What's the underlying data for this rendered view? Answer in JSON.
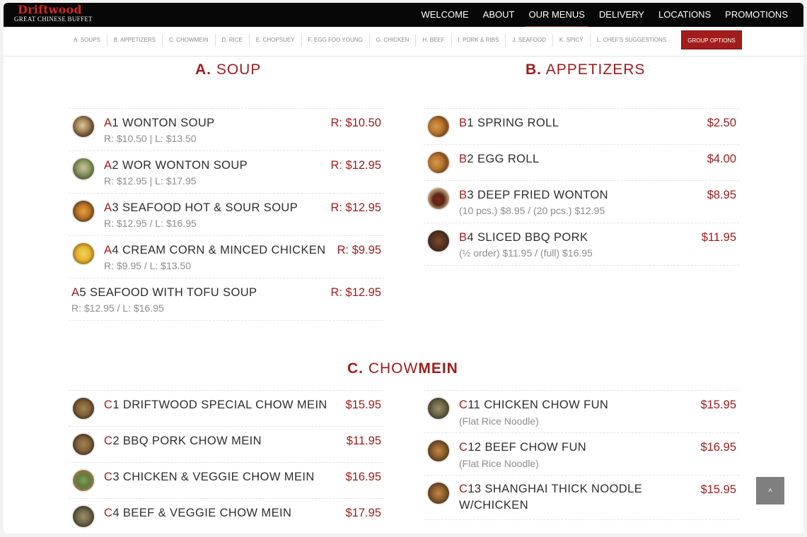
{
  "brand": {
    "name": "Driftwood",
    "tagline": "GREAT CHINESE BUFFET"
  },
  "main_nav": [
    "WELCOME",
    "ABOUT",
    "OUR MENUS",
    "DELIVERY",
    "LOCATIONS",
    "PROMOTIONS"
  ],
  "active_nav": "OUR MENUS",
  "sub_nav": [
    "A. SOUPS",
    "B. APPETIZERS",
    "C. CHOWMEIN",
    "D. RICE",
    "E. CHOPSUEY",
    "F. EGG FOO YOUNG",
    "G. CHICKEN",
    "H. BEEF",
    "I. PORK & RIBS",
    "J. SEAFOOD",
    "K. SPICY",
    "L. CHEF'S SUGGESTIONS"
  ],
  "group_options": "GROUP OPTIONS",
  "colors": {
    "accent": "#9e1b1b",
    "topbar": "#070707",
    "button": "#a31c1c"
  },
  "sections": {
    "soup": {
      "letter": "A.",
      "title": "SOUP",
      "items": [
        {
          "letter": "A",
          "num": "1 WONTON SOUP",
          "price": "R: $10.50",
          "sub": " R: $10.50 | L: $13.50",
          "thumb": "wonton-soup-photo"
        },
        {
          "letter": "A",
          "num": "2 WOR WONTON SOUP",
          "price": "R: $12.95",
          "sub": "R: $12.95 | L: $17.95",
          "thumb": "wor-wonton-soup-photo"
        },
        {
          "letter": "A",
          "num": "3 SEAFOOD HOT & SOUR SOUP",
          "price": "R: $12.95",
          "sub": "R: $12.95 / L: $16.95",
          "thumb": "hot-sour-soup-photo"
        },
        {
          "letter": "A",
          "num": "4 CREAM CORN & MINCED CHICKEN",
          "price": "R: $9.95",
          "sub": "R: $9.95 / L: $13.50",
          "thumb": "corn-soup-photo"
        },
        {
          "letter": "A",
          "num": "5 SEAFOOD WITH TOFU SOUP",
          "price": "R: $12.95",
          "sub": "R: $12.95 / L: $16.95"
        }
      ]
    },
    "appetizers": {
      "letter": "B.",
      "title": "APPETIZERS",
      "items": [
        {
          "letter": "B",
          "num": "1 SPRING ROLL",
          "price": "$2.50",
          "thumb": "spring-roll-photo"
        },
        {
          "letter": "B",
          "num": "2 EGG ROLL",
          "price": "$4.00",
          "thumb": "egg-roll-photo"
        },
        {
          "letter": "B",
          "num": "3 DEEP FRIED WONTON",
          "price": "$8.95",
          "sub": "(10 pcs.) $8.95 / (20 pcs.) $12.95",
          "thumb": "fried-wonton-photo"
        },
        {
          "letter": "B",
          "num": "4 SLICED BBQ PORK",
          "price": "$11.95",
          "sub": "(½ order) $11.95 / (full) $16.95",
          "thumb": "bbq-pork-photo"
        }
      ]
    },
    "chowmein": {
      "letter": "C.",
      "title_light": "CHOW",
      "title_bold": "MEIN",
      "left": [
        {
          "letter": "C",
          "num": "1 DRIFTWOOD SPECIAL CHOW MEIN",
          "price": "$15.95",
          "thumb": "special-chow-mein-photo"
        },
        {
          "letter": "C",
          "num": "2 BBQ PORK CHOW MEIN",
          "price": "$11.95",
          "thumb": "bbq-pork-chow-mein-photo"
        },
        {
          "letter": "C",
          "num": "3 CHICKEN & VEGGIE CHOW MEIN",
          "price": "$16.95",
          "thumb": "chicken-veggie-chow-mein-photo"
        },
        {
          "letter": "C",
          "num": "4 BEEF & VEGGIE CHOW MEIN",
          "price": "$17.95",
          "thumb": "beef-veggie-chow-mein-photo"
        }
      ],
      "right": [
        {
          "letter": "C",
          "num": "11 CHICKEN CHOW FUN",
          "price": "$15.95",
          "sub": "(Flat Rice Noodle)",
          "thumb": "chicken-chow-fun-photo"
        },
        {
          "letter": "C",
          "num": "12 BEEF CHOW FUN",
          "price": "$16.95",
          "sub": "(Flat Rice Noodle)",
          "thumb": "beef-chow-fun-photo"
        },
        {
          "letter": "C",
          "num": "13 SHANGHAI THICK NOODLE",
          "num2": "W/CHICKEN",
          "price": "$15.95",
          "thumb": "shanghai-noodle-photo"
        }
      ]
    }
  },
  "scroll_top_icon": "chevron-up-icon"
}
